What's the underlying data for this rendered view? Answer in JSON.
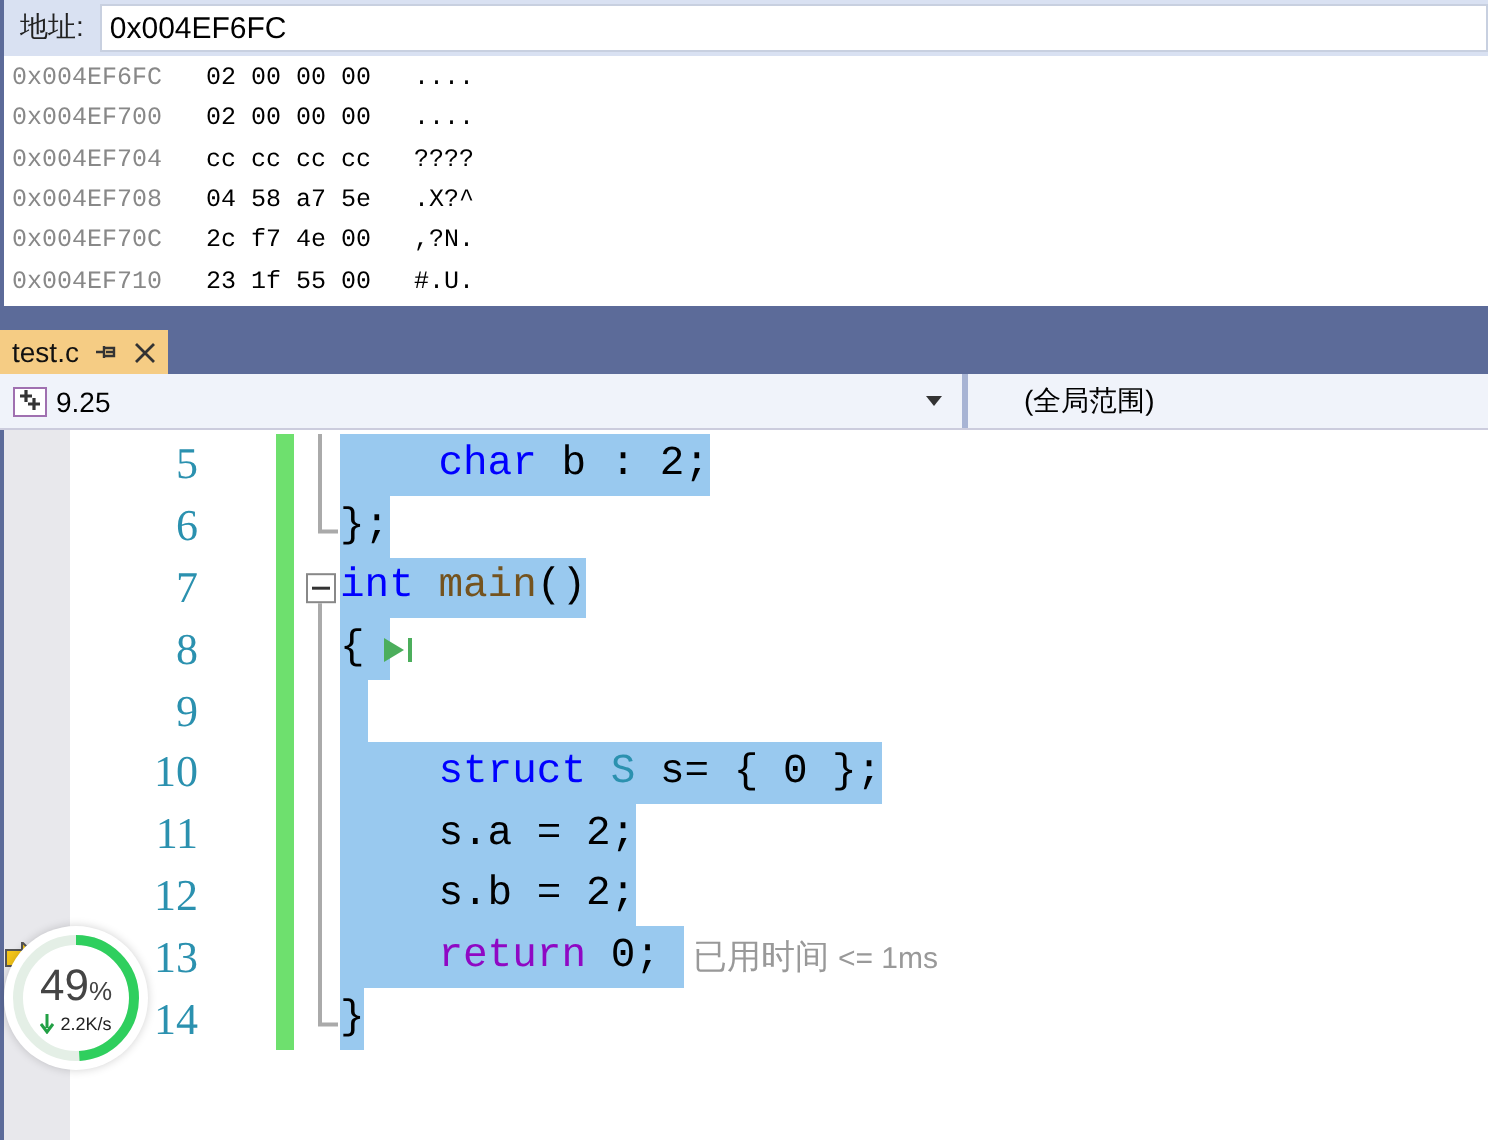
{
  "memory": {
    "address_label": "地址:",
    "address_value": "0x004EF6FC",
    "rows": [
      {
        "address": "0x004EF6FC",
        "bytes": "02 00 00 00",
        "chars": "...."
      },
      {
        "address": "0x004EF700",
        "bytes": "02 00 00 00",
        "chars": "...."
      },
      {
        "address": "0x004EF704",
        "bytes": "cc cc cc cc",
        "chars": "????"
      },
      {
        "address": "0x004EF708",
        "bytes": "04 58 a7 5e",
        "chars": ".X?^"
      },
      {
        "address": "0x004EF70C",
        "bytes": "2c f7 4e 00",
        "chars": ",?N."
      },
      {
        "address": "0x004EF710",
        "bytes": "23 1f 55 00",
        "chars": "#.U."
      }
    ]
  },
  "tabs": [
    {
      "label": "test.c",
      "selected": true
    }
  ],
  "navigation": {
    "member_dropdown": "9.25",
    "scope": "(全局范围)"
  },
  "editor": {
    "lines": [
      {
        "number": "5",
        "current": false,
        "tokens": [
          {
            "kind": "keyword",
            "text": "    char"
          },
          {
            "kind": "plain",
            "text": " b : 2;"
          }
        ]
      },
      {
        "number": "6",
        "current": false,
        "tokens": [
          {
            "kind": "plain",
            "text": "};"
          }
        ]
      },
      {
        "number": "7",
        "current": false,
        "tokens": [
          {
            "kind": "keyword",
            "text": "int"
          },
          {
            "kind": "function",
            "text": " main"
          },
          {
            "kind": "plain",
            "text": "()"
          }
        ]
      },
      {
        "number": "8",
        "current": false,
        "breakpoint_hint": true,
        "tokens": [
          {
            "kind": "plain",
            "text": "{ "
          }
        ]
      },
      {
        "number": "9",
        "current": false
      },
      {
        "number": "10",
        "current": false,
        "tokens": [
          {
            "kind": "keyword",
            "text": "    struct"
          },
          {
            "kind": "type",
            "text": " S"
          },
          {
            "kind": "plain",
            "text": " s= { 0 };"
          }
        ]
      },
      {
        "number": "11",
        "current": false,
        "tokens": [
          {
            "kind": "plain",
            "text": "    s.a = 2;"
          }
        ]
      },
      {
        "number": "12",
        "current": false,
        "tokens": [
          {
            "kind": "plain",
            "text": "    s.b = 2;"
          }
        ]
      },
      {
        "number": "13",
        "current": true,
        "hint": "已用时间",
        "hint_value": "<= 1ms",
        "tokens": [
          {
            "kind": "control",
            "text": "    return"
          },
          {
            "kind": "plain",
            "text": " 0; "
          }
        ]
      },
      {
        "number": "14",
        "current": false,
        "tokens": [
          {
            "kind": "plain",
            "text": "}"
          }
        ]
      }
    ]
  },
  "speed_widget": {
    "percent": "49",
    "unit": "%",
    "speed": "2.2K/s",
    "level": 0.49
  }
}
